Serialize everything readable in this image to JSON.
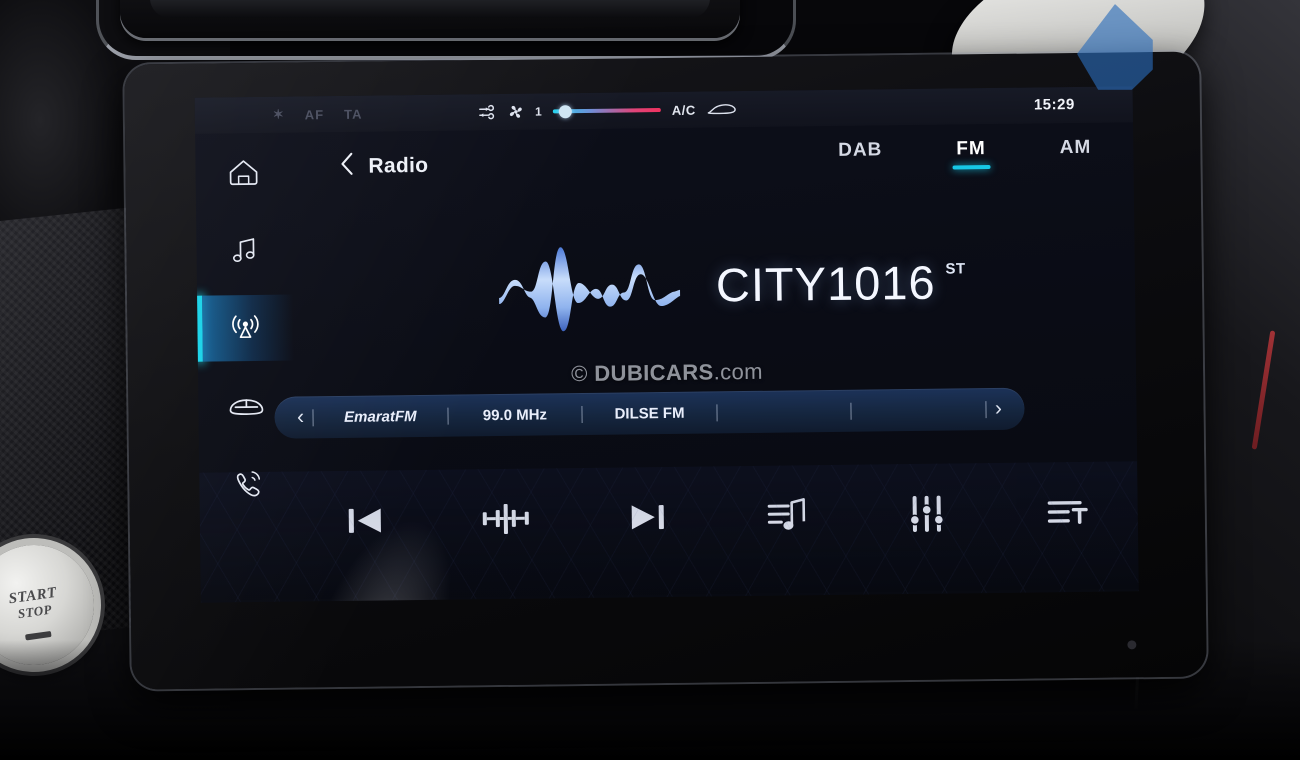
{
  "statusbar": {
    "indicators": [
      {
        "name": "bluetooth",
        "label": "✶"
      },
      {
        "name": "af",
        "label": "AF"
      },
      {
        "name": "ta",
        "label": "TA"
      }
    ],
    "recirculation_icon": "air-recirculation-icon",
    "fan_icon": "fan-icon",
    "fan_level": "1",
    "temp_slider": {
      "value_percent": 9,
      "cold_color": "#22d3ee",
      "hot_color": "#f0325f"
    },
    "ac_label": "A/C",
    "defrost_icon": "windshield-defrost-icon",
    "clock": "15:29"
  },
  "sidebar": {
    "items": [
      {
        "name": "home",
        "icon": "home-icon",
        "active": false
      },
      {
        "name": "media",
        "icon": "music-note-icon",
        "active": false
      },
      {
        "name": "radio",
        "icon": "radio-tower-icon",
        "active": true
      },
      {
        "name": "vehicle",
        "icon": "car-icon",
        "active": false
      },
      {
        "name": "phone",
        "icon": "phone-icon",
        "active": false
      }
    ],
    "active_accent": "#19d3e8"
  },
  "header": {
    "back_icon": "chevron-left-icon",
    "title": "Radio",
    "bands": [
      {
        "label": "DAB",
        "active": false
      },
      {
        "label": "FM",
        "active": true
      },
      {
        "label": "AM",
        "active": false
      }
    ],
    "band_accent": "#17c8e6"
  },
  "now_playing": {
    "waveform_icon": "audio-waveform-icon",
    "station_name": "CITY1016",
    "stereo_badge": "ST"
  },
  "watermark": {
    "symbol": "© ",
    "brand": "DUBICARS",
    "tld": ".com"
  },
  "presets": {
    "prev_icon": "chevron-left-icon",
    "next_icon": "chevron-right-icon",
    "slots": [
      {
        "type": "station",
        "label": "EmaratFM",
        "italic": true
      },
      {
        "type": "station",
        "label": "99.0 MHz",
        "italic": false
      },
      {
        "type": "station",
        "label": "DILSE FM",
        "italic": false
      },
      {
        "type": "add",
        "label": "+"
      },
      {
        "type": "add",
        "label": "+"
      }
    ],
    "add_color": "#1ecbe8"
  },
  "toolbar": {
    "items": [
      {
        "name": "previous-station",
        "icon": "skip-previous-icon"
      },
      {
        "name": "tune-scale",
        "icon": "tuning-scale-icon"
      },
      {
        "name": "next-station",
        "icon": "skip-next-icon"
      },
      {
        "name": "station-list",
        "icon": "music-list-icon"
      },
      {
        "name": "equalizer",
        "icon": "equalizer-sliders-icon"
      },
      {
        "name": "sound-settings",
        "icon": "text-settings-icon"
      }
    ]
  },
  "vehicle": {
    "start_button": {
      "line1": "START",
      "line2": "STOP"
    }
  }
}
